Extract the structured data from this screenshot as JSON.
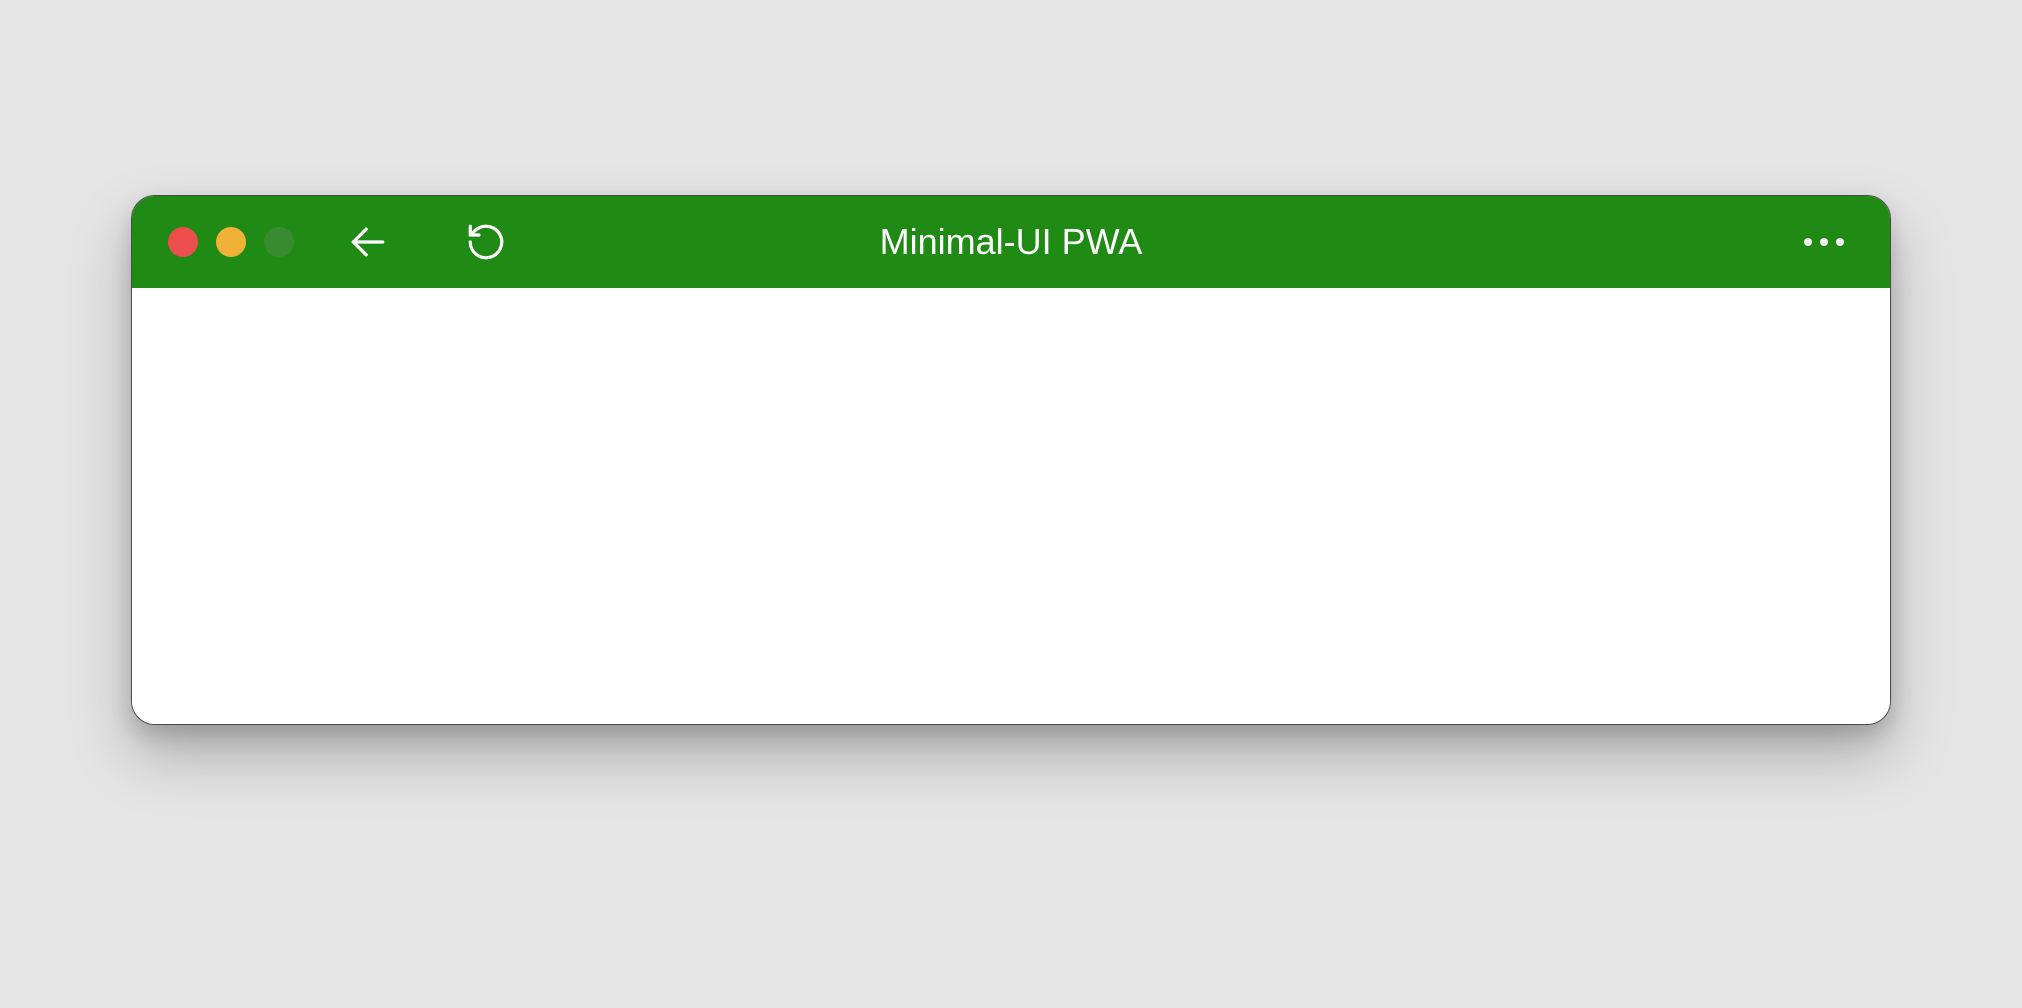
{
  "window": {
    "title": "Minimal-UI PWA",
    "titlebar_color": "#1f8a14",
    "traffic_lights": {
      "close_color": "#ec4e4d",
      "minimize_color": "#f0b137",
      "maximize_color": "#3a8a32"
    },
    "icons": {
      "back": "back-arrow-icon",
      "reload": "reload-icon",
      "menu": "more-horizontal-icon"
    }
  }
}
